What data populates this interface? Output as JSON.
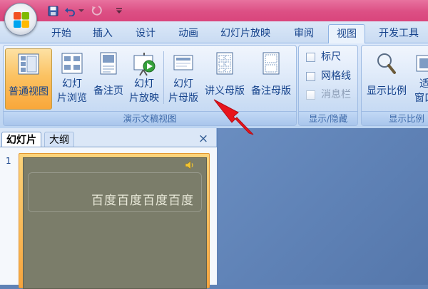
{
  "quick_access": {
    "icons": [
      "save-icon",
      "undo-icon",
      "dropdown-icon",
      "redo-icon",
      "customize-icon"
    ]
  },
  "tabs": [
    "开始",
    "插入",
    "设计",
    "动画",
    "幻灯片放映",
    "审阅",
    "视图",
    "开发工具"
  ],
  "active_tab": "视图",
  "ribbon": {
    "presentation_views": {
      "label": "演示文稿视图",
      "normal": "普通视图",
      "sorter_1": "幻灯",
      "sorter_2": "片浏览",
      "notes": "备注页",
      "slideshow_1": "幻灯",
      "slideshow_2": "片放映",
      "slide_master_1": "幻灯",
      "slide_master_2": "片母版",
      "handout_master": "讲义母版",
      "notes_master": "备注母版"
    },
    "show_hide": {
      "label": "显示/隐藏",
      "ruler": "标尺",
      "gridlines": "网格线",
      "message_bar": "消息栏"
    },
    "zoom": {
      "label": "显示比例",
      "zoom": "显示比例",
      "fit_window_1": "适",
      "fit_window_2": "窗口"
    }
  },
  "left_pane": {
    "tab_slides": "幻灯片",
    "tab_outline": "大纲",
    "close": "×",
    "slide_number": "1",
    "slide_text": "百度百度百度百度"
  },
  "colors": {
    "title_bar": "#dc4f84",
    "ribbon_bg": "#c6daf3",
    "selected_button": "#fbc262",
    "slide_background": "#7b7d6a",
    "arrow": "#e8141c"
  }
}
